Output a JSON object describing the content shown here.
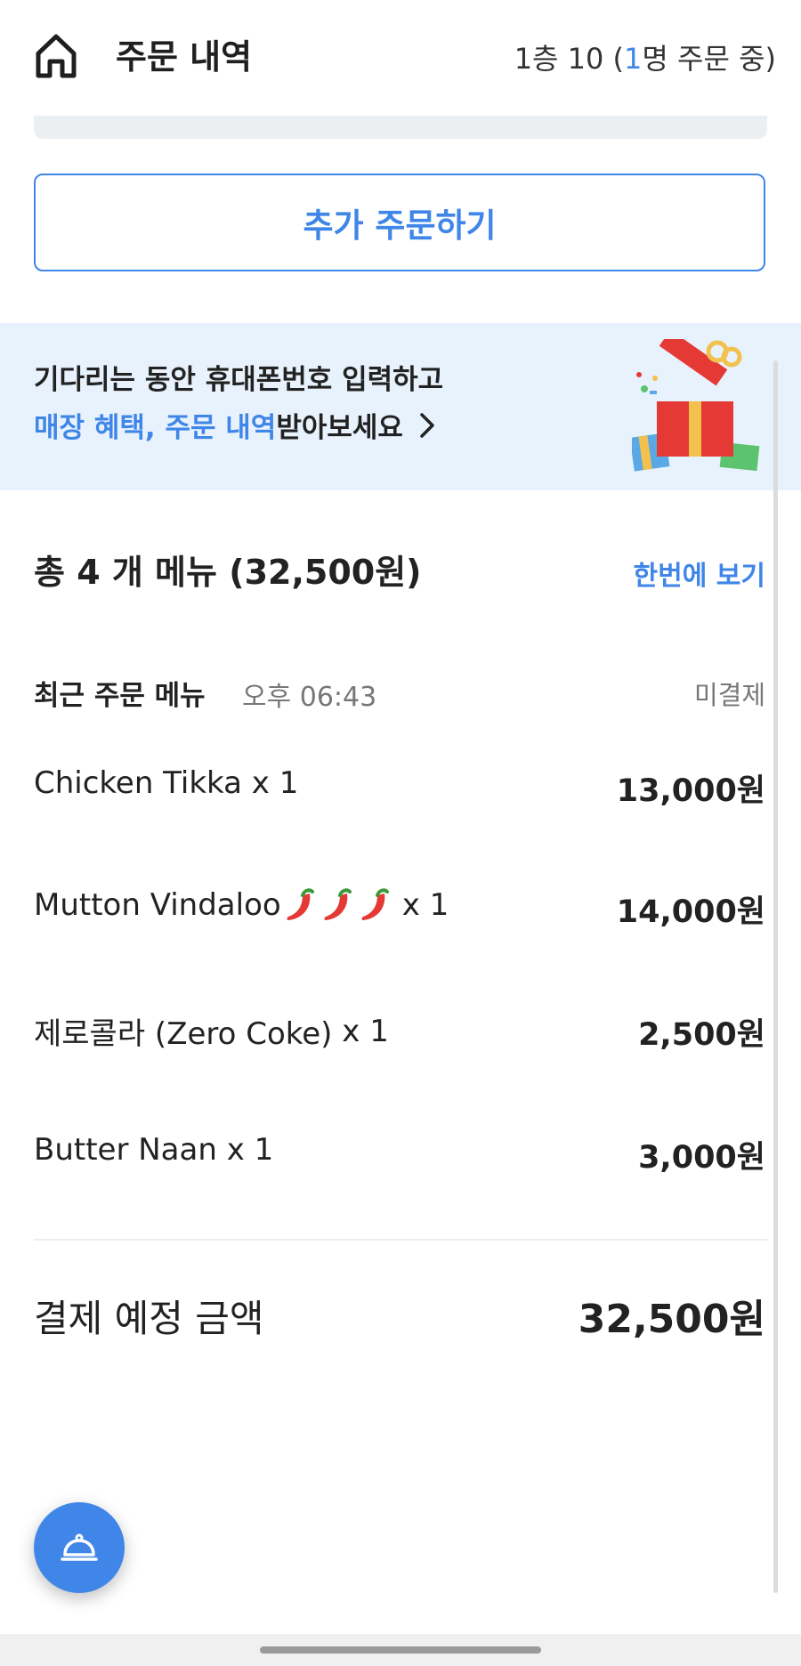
{
  "header": {
    "title": "주문 내역",
    "table_prefix": "1층 10 (",
    "ordering_count": "1",
    "table_suffix": "명 주문 중)"
  },
  "actions": {
    "add_order_label": "추가 주문하기"
  },
  "promo": {
    "line1": "기다리는 동안 휴대폰번호 입력하고",
    "line2_highlight": "매장 혜택, 주문 내역",
    "line2_rest": " 받아보세요"
  },
  "summary": {
    "title": "총 4 개 메뉴 (32,500원)",
    "view_all_label": "한번에 보기"
  },
  "recent": {
    "label": "최근 주문 메뉴",
    "time": "오후 06:43",
    "status": "미결제"
  },
  "items": [
    {
      "name": "Chicken Tikka",
      "qty": "x 1",
      "price": "13,000원",
      "chili_count": 0
    },
    {
      "name": "Mutton Vindaloo",
      "qty": "x 1",
      "price": "14,000원",
      "chili_count": 3
    },
    {
      "name": "제로콜라 (Zero Coke)",
      "qty": "x 1",
      "price": "2,500원",
      "chili_count": 0
    },
    {
      "name": "Butter Naan",
      "qty": "x 1",
      "price": "3,000원",
      "chili_count": 0
    }
  ],
  "total": {
    "label": "결제 예정 금액",
    "value": "32,500원"
  },
  "colors": {
    "accent": "#3f86e8",
    "promo_bg": "#e8f2fc"
  },
  "icons": {
    "home": "home-icon",
    "chevron": "chevron-right-icon",
    "gift": "gift-box-icon",
    "fab": "cloche-icon",
    "chili": "chili-pepper-icon"
  }
}
